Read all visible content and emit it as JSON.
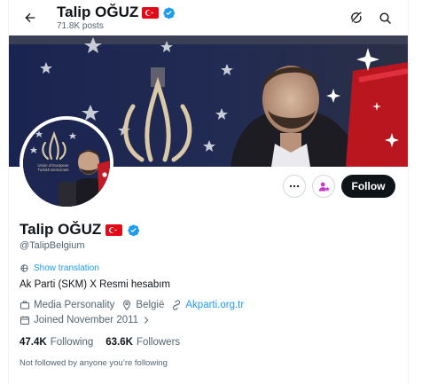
{
  "header": {
    "name": "Talip OĞUZ",
    "posts": "71.8K posts"
  },
  "profile": {
    "name": "Talip OĞUZ",
    "handle": "@TalipBelgium",
    "show_translation": "Show translation",
    "bio": "Ak Parti (SKM) X Resmi hesabım",
    "category": "Media Personality",
    "location": "België",
    "website": "Akparti.org.tr",
    "joined": "Joined November 2011",
    "following_count": "47.4K",
    "following_label": "Following",
    "followers_count": "63.6K",
    "followers_label": "Followers",
    "not_followed": "Not followed by anyone you’re following"
  },
  "actions": {
    "follow_label": "Follow"
  },
  "avatar_banner_text": "Union of European Turkish Democrats",
  "colors": {
    "accent": "#1d9bf0",
    "verified": "#1d9bf0",
    "flag_red": "#e30a17",
    "follow_bg": "#0f1419",
    "subscribe_purple": "#c936cc"
  }
}
